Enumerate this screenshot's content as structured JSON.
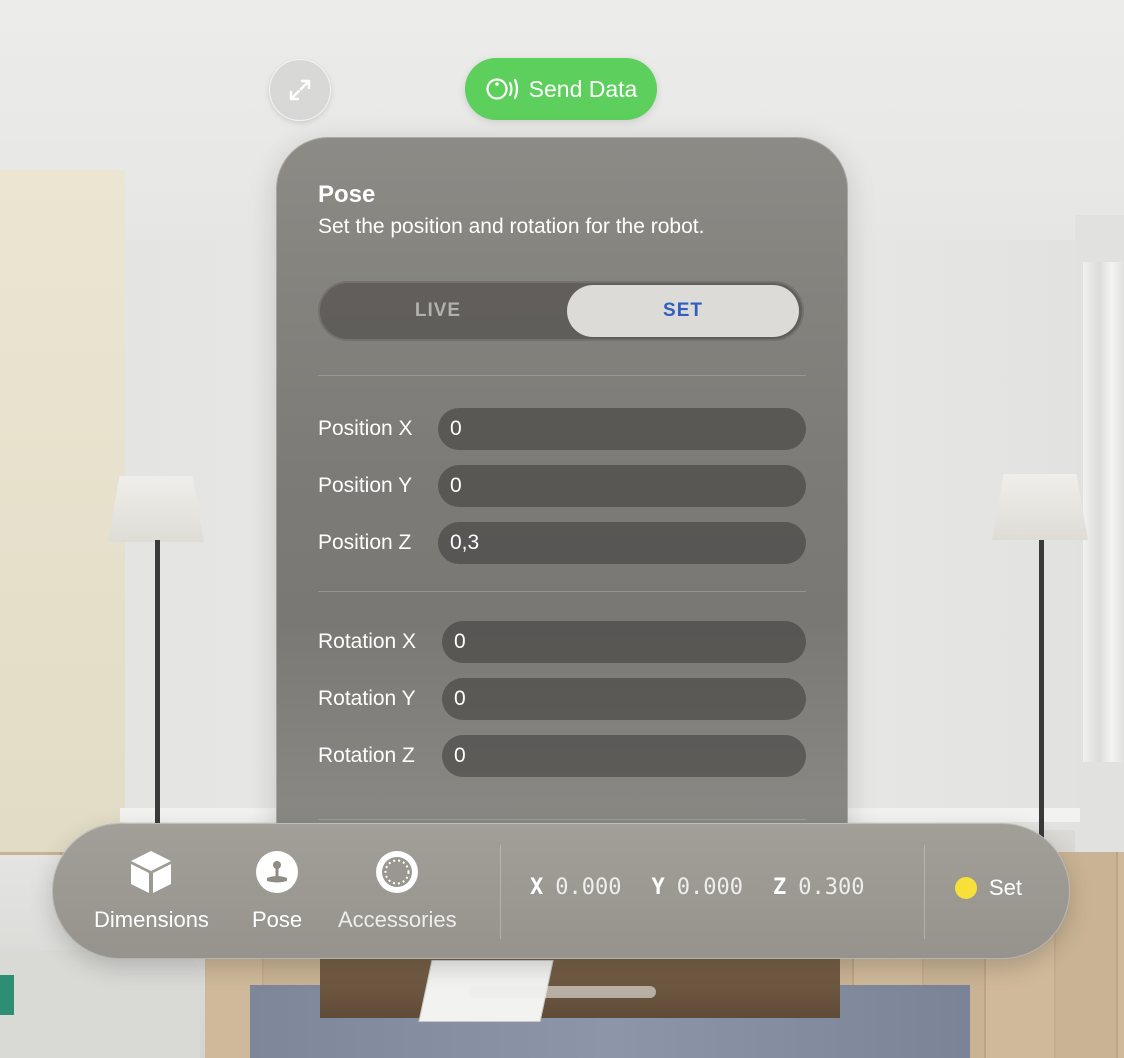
{
  "top": {
    "expand_icon": "expand-arrows-icon",
    "send_button": {
      "label": "Send Data",
      "icon": "broadcast-icon",
      "color": "#5ccf5c"
    }
  },
  "panel": {
    "title": "Pose",
    "subtitle": "Set the position and rotation for the robot.",
    "mode": {
      "options": [
        "LIVE",
        "SET"
      ],
      "selected": "SET",
      "live_label": "LIVE",
      "set_label": "SET"
    },
    "position": [
      {
        "label": "Position X",
        "value": "0"
      },
      {
        "label": "Position Y",
        "value": "0"
      },
      {
        "label": "Position Z",
        "value": "0,3"
      }
    ],
    "rotation": [
      {
        "label": "Rotation X",
        "value": "0"
      },
      {
        "label": "Rotation Y",
        "value": "0"
      },
      {
        "label": "Rotation Z",
        "value": "0"
      }
    ]
  },
  "toolbar": {
    "tabs": [
      {
        "label": "Dimensions",
        "icon": "cube-icon"
      },
      {
        "label": "Pose",
        "icon": "joystick-icon",
        "selected": true
      },
      {
        "label": "Accessories",
        "icon": "ring-icon"
      }
    ],
    "coords": [
      {
        "axis": "X",
        "value": "0.000"
      },
      {
        "axis": "Y",
        "value": "0.000"
      },
      {
        "axis": "Z",
        "value": "0.300"
      }
    ],
    "status": {
      "label": "Set",
      "color": "#f7e03a"
    }
  }
}
